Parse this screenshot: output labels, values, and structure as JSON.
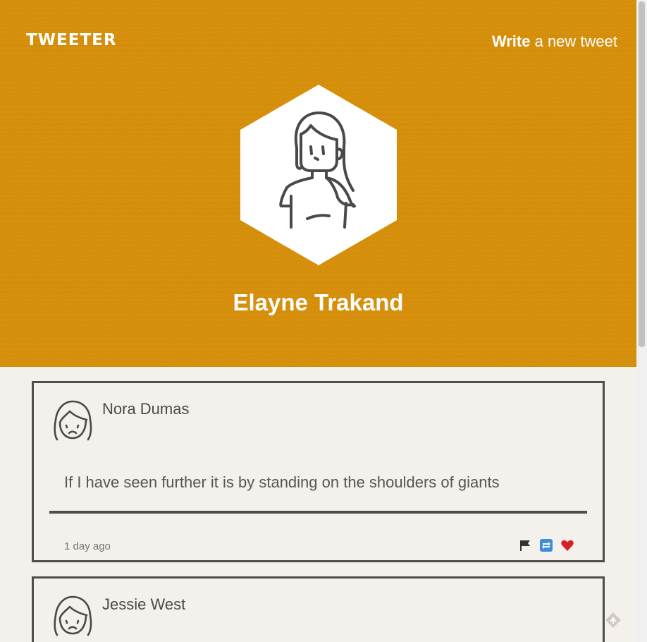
{
  "header": {
    "logo": "TWEETER",
    "compose_bold": "Write",
    "compose_rest": " a new tweet"
  },
  "profile": {
    "name": "Elayne Trakand",
    "avatar_icon": "woman-avatar-icon"
  },
  "tweets": [
    {
      "author": "Nora Dumas",
      "text": "If I have seen further it is by standing on the shoulders of giants",
      "time": "1 day ago",
      "avatar_icon": "sad-woman-icon",
      "actions": [
        "flag-icon",
        "retweet-icon",
        "heart-icon"
      ]
    },
    {
      "author": "Jessie West",
      "avatar_icon": "sad-woman-icon"
    }
  ],
  "colors": {
    "hero": "#d8900a",
    "background": "#f4f1ec",
    "border": "#4d4d4d",
    "heart": "#d61f26",
    "retweet": "#3b8fd9"
  }
}
